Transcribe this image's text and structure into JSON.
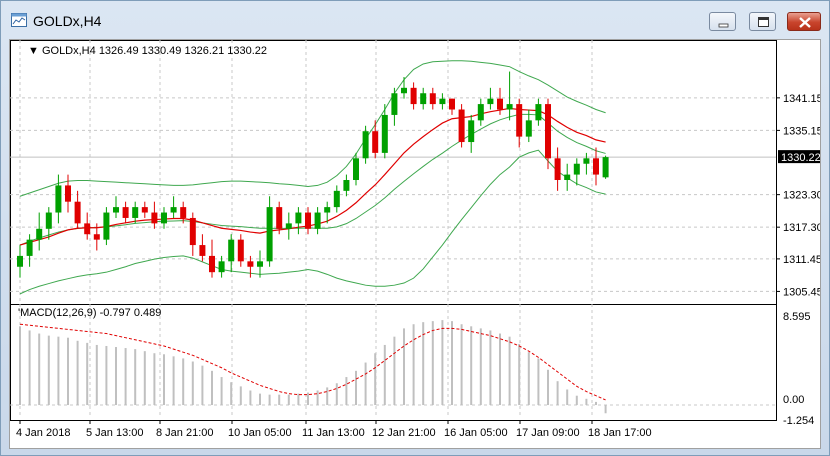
{
  "window": {
    "title": "GOLDx,H4",
    "minimize_icon": "minimize-icon",
    "maximize_icon": "maximize-icon",
    "close_icon": "close-icon"
  },
  "chart": {
    "symbol_tf": "GOLDx,H4",
    "ohlc": "1326.49 1330.49 1326.21 1330.22",
    "indicator_label": "MACD(12,26,9) -0.797 0.489",
    "current_price": "1330.22",
    "colors": {
      "bull": "#00a000",
      "bear": "#e00000",
      "ma": "#e00000",
      "band": "#3fa84f",
      "macd_hist": "#c0c0c0",
      "signal": "#e00000"
    }
  },
  "chart_data": {
    "type": "candlestick",
    "price_ticks": [
      "1341.15",
      "1335.15",
      "1323.30",
      "1317.30",
      "1311.45",
      "1305.45"
    ],
    "price_range": [
      1305.45,
      1345
    ],
    "macd_ticks": [
      "8.595",
      "0.00",
      "-1.254"
    ],
    "x_ticks": [
      "4 Jan 2018",
      "5 Jan 13:00",
      "8 Jan 21:00",
      "10 Jan 05:00",
      "11 Jan 13:00",
      "12 Jan 21:00",
      "16 Jan 05:00",
      "17 Jan 09:00",
      "18 Jan 17:00"
    ],
    "candles": [
      [
        1310,
        1314,
        1308,
        1312
      ],
      [
        1312,
        1316,
        1310,
        1315
      ],
      [
        1315,
        1320,
        1313,
        1317
      ],
      [
        1317,
        1321,
        1315,
        1320
      ],
      [
        1320,
        1327,
        1318,
        1325
      ],
      [
        1325,
        1327,
        1320,
        1322
      ],
      [
        1322,
        1324,
        1317,
        1318
      ],
      [
        1318,
        1320,
        1315,
        1316
      ],
      [
        1316,
        1318,
        1313,
        1315
      ],
      [
        1315,
        1321,
        1314,
        1320
      ],
      [
        1320,
        1323,
        1319,
        1321
      ],
      [
        1321,
        1322,
        1318,
        1319
      ],
      [
        1319,
        1322,
        1318,
        1321
      ],
      [
        1321,
        1322,
        1319,
        1320
      ],
      [
        1320,
        1322,
        1317,
        1318
      ],
      [
        1318,
        1321,
        1317,
        1320
      ],
      [
        1320,
        1323,
        1319,
        1321
      ],
      [
        1321,
        1322,
        1318,
        1319
      ],
      [
        1319,
        1320,
        1312,
        1314
      ],
      [
        1314,
        1316,
        1311,
        1312
      ],
      [
        1312,
        1315,
        1308,
        1309
      ],
      [
        1309,
        1312,
        1308,
        1311
      ],
      [
        1311,
        1316,
        1309,
        1315
      ],
      [
        1315,
        1316,
        1310,
        1311
      ],
      [
        1311,
        1312,
        1308,
        1310
      ],
      [
        1310,
        1313,
        1308,
        1311
      ],
      [
        1311,
        1323,
        1310,
        1321
      ],
      [
        1321,
        1322,
        1316,
        1317
      ],
      [
        1317,
        1320,
        1315,
        1318
      ],
      [
        1318,
        1321,
        1316,
        1320
      ],
      [
        1320,
        1321,
        1316,
        1317
      ],
      [
        1317,
        1321,
        1316,
        1320
      ],
      [
        1320,
        1322,
        1318,
        1321
      ],
      [
        1321,
        1325,
        1320,
        1324
      ],
      [
        1324,
        1327,
        1323,
        1326
      ],
      [
        1326,
        1331,
        1325,
        1330
      ],
      [
        1330,
        1336,
        1329,
        1335
      ],
      [
        1335,
        1337,
        1330,
        1331
      ],
      [
        1331,
        1340,
        1330,
        1338
      ],
      [
        1338,
        1343,
        1336,
        1342
      ],
      [
        1342,
        1345,
        1341,
        1343
      ],
      [
        1343,
        1344,
        1339,
        1340
      ],
      [
        1340,
        1343,
        1339,
        1342
      ],
      [
        1342,
        1343,
        1339,
        1340
      ],
      [
        1340,
        1342,
        1339,
        1341
      ],
      [
        1341,
        1341,
        1338,
        1339
      ],
      [
        1339,
        1340,
        1332,
        1333
      ],
      [
        1333,
        1338,
        1331,
        1337
      ],
      [
        1337,
        1341,
        1336,
        1340
      ],
      [
        1340,
        1343,
        1339,
        1341
      ],
      [
        1341,
        1343,
        1338,
        1339
      ],
      [
        1339,
        1346,
        1337,
        1340
      ],
      [
        1340,
        1341,
        1332,
        1334
      ],
      [
        1334,
        1339,
        1333,
        1337
      ],
      [
        1337,
        1341,
        1336,
        1340
      ],
      [
        1340,
        1341,
        1328,
        1330
      ],
      [
        1330,
        1332,
        1324,
        1326
      ],
      [
        1326,
        1329,
        1324,
        1327
      ],
      [
        1327,
        1330,
        1325,
        1329
      ],
      [
        1329,
        1331,
        1327,
        1330
      ],
      [
        1330,
        1332,
        1325,
        1327
      ],
      [
        1326.49,
        1330.49,
        1326.21,
        1330.22
      ]
    ],
    "ma_line": [
      1314,
      1314.5,
      1315,
      1315.5,
      1316.2,
      1316.8,
      1317.1,
      1317.2,
      1317.2,
      1317.4,
      1317.8,
      1318.1,
      1318.4,
      1318.6,
      1318.7,
      1318.8,
      1318.9,
      1318.9,
      1318.6,
      1318.1,
      1317.6,
      1317.1,
      1316.9,
      1316.7,
      1316.4,
      1316.2,
      1316.6,
      1316.8,
      1317.0,
      1317.3,
      1317.5,
      1317.9,
      1318.4,
      1319.3,
      1320.4,
      1321.8,
      1323.5,
      1325.1,
      1327.0,
      1329.0,
      1331.0,
      1332.6,
      1334.0,
      1335.3,
      1336.5,
      1337.3,
      1337.5,
      1337.7,
      1338.2,
      1338.6,
      1338.9,
      1339.2,
      1339.0,
      1338.9,
      1338.8,
      1338.0,
      1336.8,
      1335.7,
      1334.8,
      1334.2,
      1333.4,
      1333.0
    ],
    "band_upper": [
      1323,
      1323.6,
      1324.2,
      1324.8,
      1325.4,
      1325.8,
      1325.9,
      1325.9,
      1325.8,
      1325.7,
      1325.6,
      1325.5,
      1325.4,
      1325.3,
      1325.2,
      1325.1,
      1325.0,
      1325.0,
      1325.1,
      1325.3,
      1325.5,
      1325.7,
      1325.8,
      1325.8,
      1325.7,
      1325.6,
      1325.5,
      1325.3,
      1325.2,
      1325.0,
      1324.8,
      1325.0,
      1325.6,
      1326.8,
      1328.5,
      1330.8,
      1333.6,
      1336.2,
      1339.0,
      1342.0,
      1344.5,
      1346.4,
      1347.4,
      1347.8,
      1347.9,
      1348.0,
      1348.0,
      1347.9,
      1347.7,
      1347.5,
      1347.2,
      1346.9,
      1346.0,
      1345.2,
      1344.5,
      1343.5,
      1342.4,
      1341.3,
      1340.5,
      1339.8,
      1339.0,
      1338.4
    ],
    "band_lower": [
      1305,
      1305.8,
      1306.4,
      1306.9,
      1307.4,
      1307.8,
      1308.2,
      1308.5,
      1308.7,
      1309.0,
      1309.5,
      1310.0,
      1310.6,
      1311.0,
      1311.4,
      1311.7,
      1311.9,
      1312.0,
      1311.6,
      1310.9,
      1310.2,
      1309.5,
      1309.2,
      1309.0,
      1308.8,
      1308.6,
      1308.7,
      1308.8,
      1309.0,
      1309.2,
      1309.5,
      1309.2,
      1308.6,
      1307.9,
      1307.4,
      1307.0,
      1306.6,
      1306.4,
      1306.4,
      1306.6,
      1307.0,
      1307.9,
      1309.6,
      1311.8,
      1314.0,
      1316.4,
      1318.7,
      1320.9,
      1323.1,
      1325.2,
      1327.0,
      1328.4,
      1330.2,
      1331.0,
      1331.5,
      1329.5,
      1327.6,
      1326.4,
      1325.3,
      1324.6,
      1323.8,
      1323.4
    ],
    "macd_hist": [
      7.6,
      7.2,
      6.9,
      6.7,
      6.6,
      6.5,
      6.2,
      6.0,
      5.8,
      5.7,
      5.6,
      5.5,
      5.4,
      5.2,
      5.0,
      4.9,
      4.7,
      4.5,
      4.2,
      3.8,
      3.3,
      2.7,
      2.2,
      1.8,
      1.4,
      1.1,
      1.0,
      1.0,
      1.0,
      1.1,
      1.2,
      1.4,
      1.7,
      2.1,
      2.7,
      3.3,
      4.1,
      5.0,
      5.8,
      6.6,
      7.4,
      7.8,
      8.0,
      8.1,
      8.2,
      8.1,
      7.8,
      7.6,
      7.4,
      7.2,
      6.9,
      6.6,
      5.9,
      5.1,
      4.5,
      3.4,
      2.3,
      1.5,
      0.9,
      0.6,
      0.3,
      -0.797
    ],
    "macd_signal": [
      7.8,
      7.7,
      7.6,
      7.5,
      7.4,
      7.3,
      7.2,
      7.1,
      7.0,
      6.9,
      6.7,
      6.5,
      6.3,
      6.1,
      5.9,
      5.7,
      5.4,
      5.1,
      4.8,
      4.4,
      4.0,
      3.6,
      3.1,
      2.7,
      2.3,
      1.9,
      1.6,
      1.3,
      1.1,
      1.0,
      1.0,
      1.1,
      1.3,
      1.6,
      2.0,
      2.5,
      3.0,
      3.6,
      4.3,
      5.0,
      5.7,
      6.3,
      6.8,
      7.2,
      7.4,
      7.4,
      7.3,
      7.1,
      6.9,
      6.7,
      6.4,
      6.1,
      5.7,
      5.2,
      4.6,
      3.9,
      3.2,
      2.5,
      1.8,
      1.3,
      0.9,
      0.489
    ]
  }
}
